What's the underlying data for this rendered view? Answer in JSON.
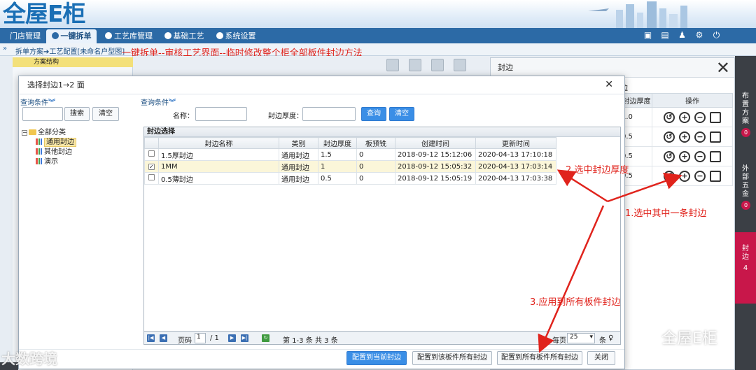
{
  "app": {
    "logo": "全屋E柜",
    "nav_tabs": [
      "门店管理",
      "一键拆单",
      "工艺库管理",
      "基础工艺",
      "系统设置"
    ],
    "breadcrumb": "拆单方案➔工艺配置[未命名户型图]"
  },
  "annotations": {
    "top": "一键拆单--审核工艺界面--临时修改整个柜全部板件封边方法",
    "step1": "1.选中其中一条封边",
    "step2": "2.选中封边厚度",
    "step3": "3.应用到所有板件封边"
  },
  "left_panel": {
    "title": "方案结构"
  },
  "bg_panel": {
    "title": "封边",
    "section": "边",
    "col_thickness": "封边厚度",
    "col_ops": "操作",
    "thickness_values": [
      "1.0",
      "0.5",
      "0.5",
      "0.5"
    ]
  },
  "right_sidebar": [
    {
      "label": "布置方案",
      "count": "0"
    },
    {
      "label": "外部五金",
      "count": "0"
    },
    {
      "label": "封边",
      "count": "4"
    }
  ],
  "modal": {
    "title": "选择封边1→2 面",
    "left_query_label": "查询条件",
    "search_btn": "搜索",
    "clear_btn": "清空",
    "right_query_label": "查询条件",
    "name_label": "名称：",
    "thickness_label": "封边厚度：",
    "query_btn": "查询",
    "clear_btn2": "清空",
    "tree": {
      "root": "全部分类",
      "children": [
        "通用封边",
        "其他封边",
        "演示"
      ]
    },
    "grid": {
      "caption": "封边选择",
      "columns": [
        "封边名称",
        "类别",
        "封边厚度",
        "板预铣",
        "创建时间",
        "更新时间"
      ],
      "rows": [
        {
          "name": "1.5厚封边",
          "type": "通用封边",
          "thickness": "1.5",
          "mill": "0",
          "created": "2018-09-12 15:12:06",
          "updated": "2020-04-13 17:10:18",
          "checked": false
        },
        {
          "name": "1MM",
          "type": "通用封边",
          "thickness": "1",
          "mill": "0",
          "created": "2018-09-12 15:05:32",
          "updated": "2020-04-13 17:03:14",
          "checked": true
        },
        {
          "name": "0.5薄封边",
          "type": "通用封边",
          "thickness": "0.5",
          "mill": "0",
          "created": "2018-09-12 15:05:19",
          "updated": "2020-04-13 17:03:38",
          "checked": false
        }
      ]
    },
    "pager": {
      "page_label": "页码",
      "page": "1",
      "total_pages": "/ 1",
      "range": "第 1-3 条",
      "total": "共 3 条",
      "per_page_label": "每页",
      "per_page": "25",
      "unit": "条"
    },
    "footer": {
      "btn_current": "配置到当前封边",
      "btn_board": "配置到该板件所有封边",
      "btn_all": "配置到所有板件所有封边",
      "btn_close": "关闭"
    }
  },
  "watermarks": {
    "left": "大数跨境",
    "right": "全屋E柜"
  }
}
